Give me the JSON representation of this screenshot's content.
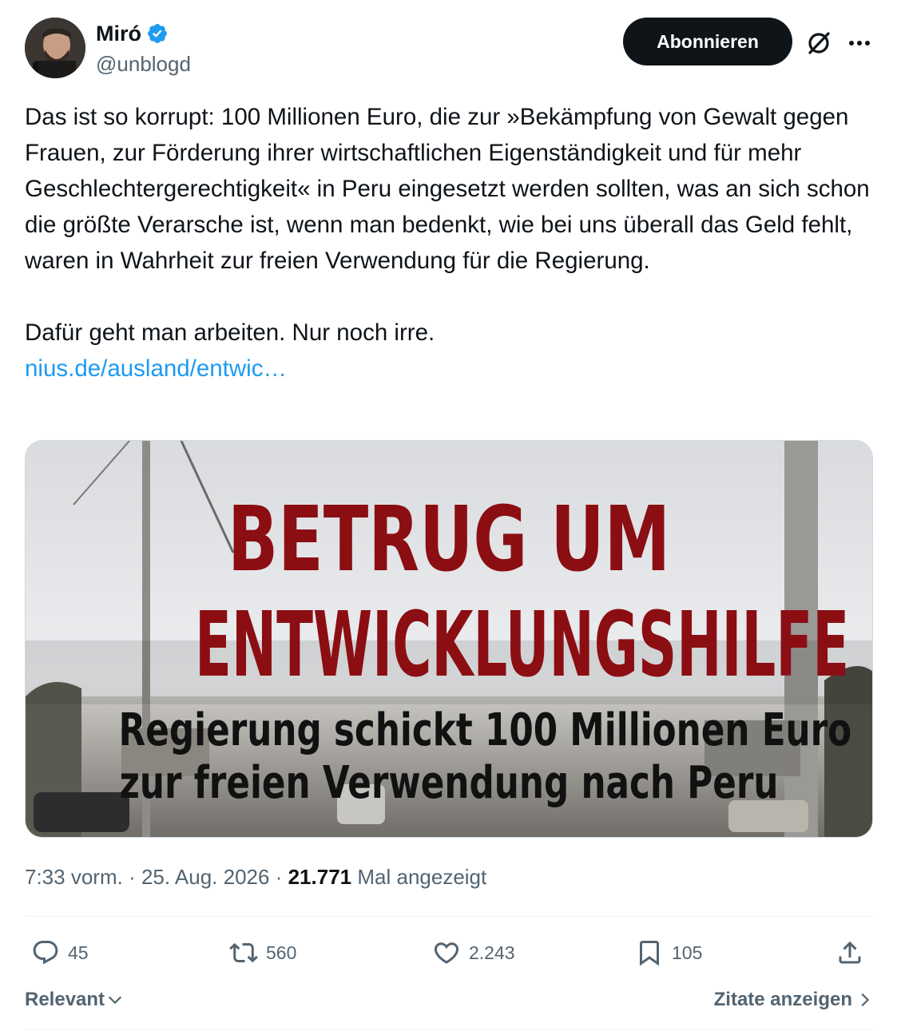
{
  "author": {
    "display_name": "Miró",
    "handle": "@unblogd",
    "verified": true,
    "verified_color": "#1d9bf0"
  },
  "header": {
    "subscribe_label": "Abonnieren",
    "grok_icon": "grok-icon",
    "more_icon": "more-options-icon"
  },
  "tweet": {
    "paragraph_1": "Das ist so korrupt: 100 Millionen Euro, die zur »Bekämpfung von Gewalt gegen Frauen, zur Förderung ihrer wirtschaftlichen Eigenständigkeit und für mehr Geschlechtergerechtigkeit« in Peru eingesetzt werden sollten, was an sich schon die größte Verarsche ist, wenn man bedenkt, wie bei uns überall das Geld fehlt, waren in Wahrheit zur freien Verwendung für die Regierung.",
    "paragraph_2": "Dafür geht man arbeiten. Nur noch irre.",
    "link_text": "nius.de/ausland/entwic…",
    "link_color": "#1d9bf0"
  },
  "media": {
    "headline_line_1": "BETRUG UM",
    "headline_line_2": "ENTWICKLUNGSHILFE",
    "subheadline_line_1": "Regierung schickt 100 Millionen Euro",
    "subheadline_line_2": "zur freien Verwendung nach Peru",
    "headline_color": "#8b0e13"
  },
  "meta": {
    "time": "7:33 vorm.",
    "separator": "·",
    "date": "25. Aug. 2026",
    "views_count": "21.771",
    "views_label": "Mal angezeigt"
  },
  "actions": {
    "replies": "45",
    "reposts": "560",
    "likes": "2.243",
    "bookmarks": "105"
  },
  "footer": {
    "sort_label": "Relevant",
    "quotes_label": "Zitate anzeigen"
  }
}
